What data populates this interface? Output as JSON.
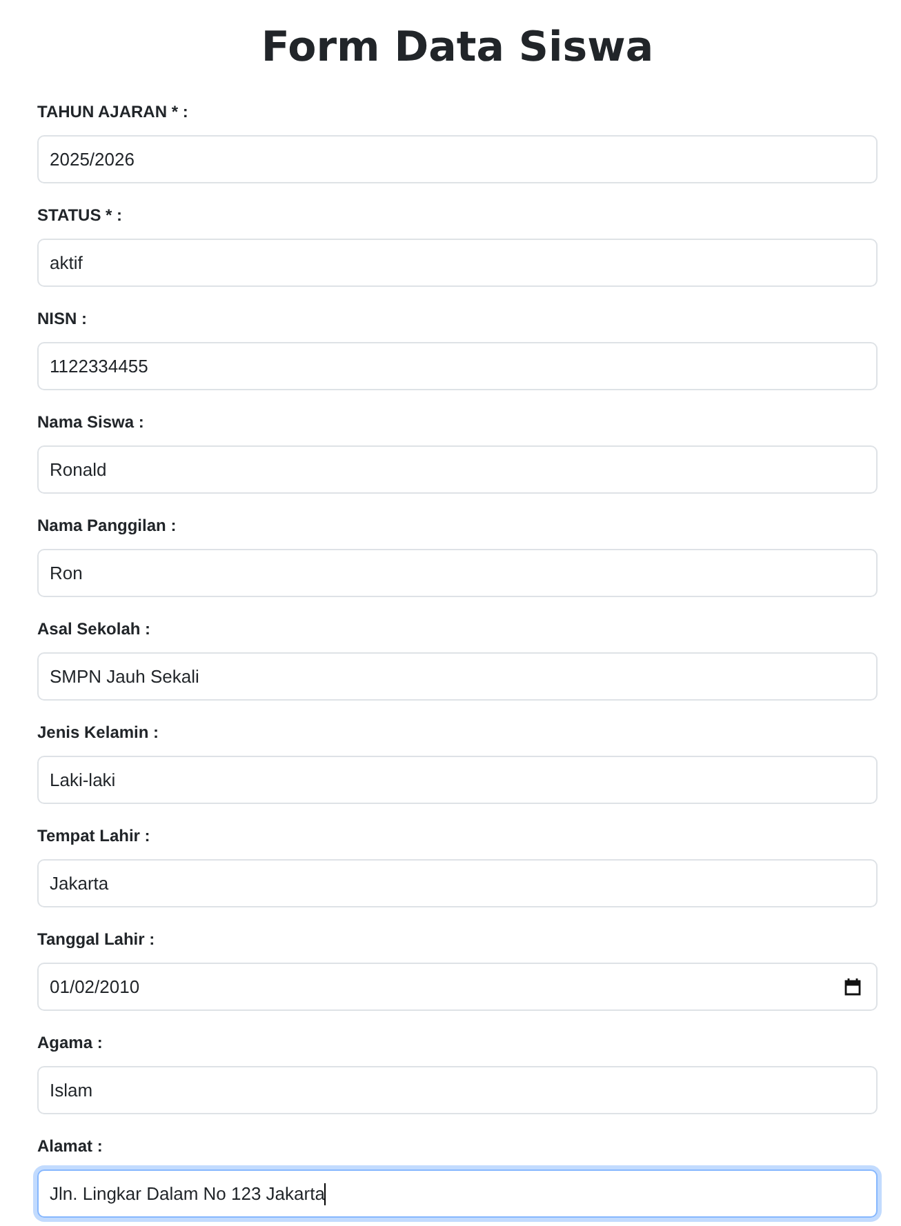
{
  "title": "Form Data Siswa",
  "fields": [
    {
      "label": "TAHUN AJARAN * :",
      "value": "2025/2026",
      "kind": "text",
      "focused": false
    },
    {
      "label": "STATUS * :",
      "value": "aktif",
      "kind": "text",
      "focused": false
    },
    {
      "label": "NISN :",
      "value": "1122334455",
      "kind": "text",
      "focused": false
    },
    {
      "label": "Nama Siswa :",
      "value": "Ronald",
      "kind": "text",
      "focused": false
    },
    {
      "label": "Nama Panggilan :",
      "value": "Ron",
      "kind": "text",
      "focused": false
    },
    {
      "label": "Asal Sekolah :",
      "value": "SMPN Jauh Sekali",
      "kind": "text",
      "focused": false
    },
    {
      "label": "Jenis Kelamin :",
      "value": "Laki-laki",
      "kind": "text",
      "focused": false
    },
    {
      "label": "Tempat Lahir :",
      "value": "Jakarta",
      "kind": "text",
      "focused": false
    },
    {
      "label": "Tanggal Lahir :",
      "value": "01/02/2010",
      "kind": "date",
      "focused": false
    },
    {
      "label": "Agama :",
      "value": "Islam",
      "kind": "text",
      "focused": false
    },
    {
      "label": "Alamat :",
      "value": "Jln. Lingkar Dalam No 123 Jakarta",
      "kind": "text",
      "focused": true
    }
  ]
}
